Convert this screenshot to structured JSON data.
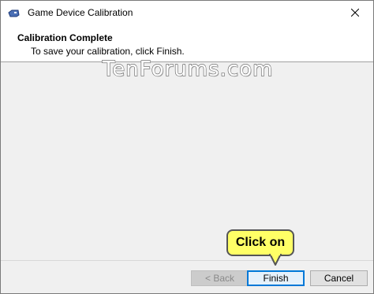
{
  "window": {
    "title": "Game Device Calibration"
  },
  "icons": {
    "app": "game-controller-icon",
    "close": "close-icon"
  },
  "header": {
    "title": "Calibration Complete",
    "subtitle": "To save your calibration, click Finish."
  },
  "watermark": {
    "text": "TenForums.com"
  },
  "buttons": {
    "back": "< Back",
    "finish": "Finish",
    "cancel": "Cancel"
  },
  "annotation": {
    "text": "Click on",
    "color": "#ffff66"
  },
  "colors": {
    "accent": "#0078d7",
    "content_bg": "#f0f0f0"
  }
}
